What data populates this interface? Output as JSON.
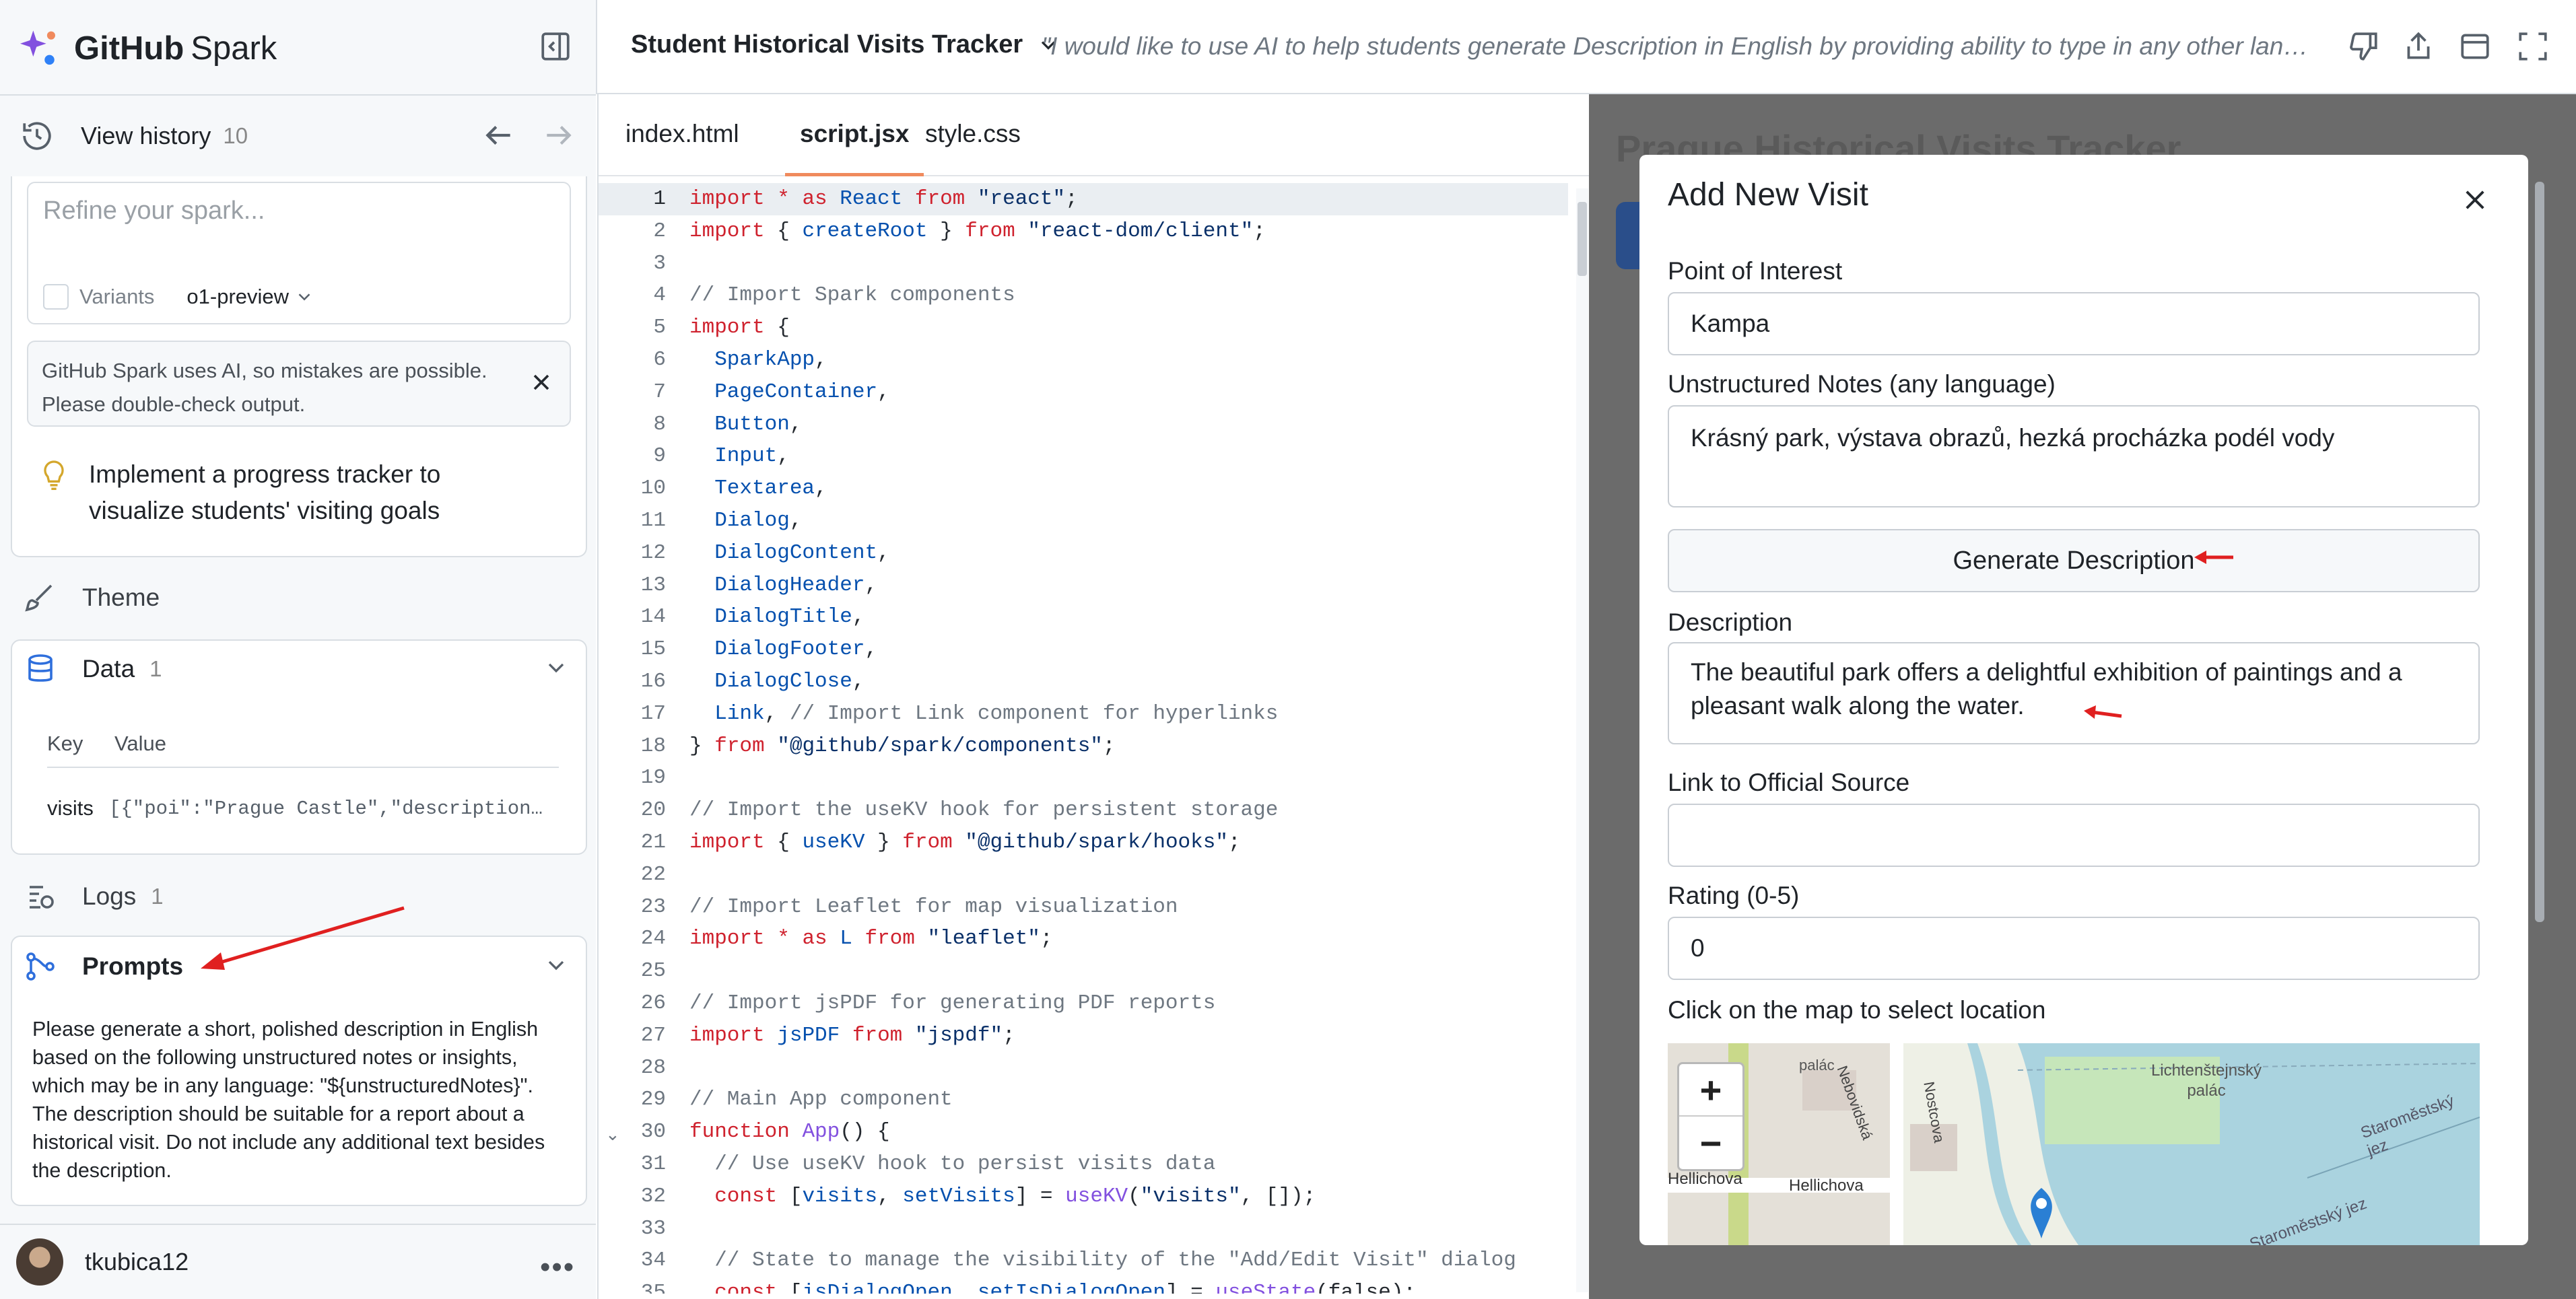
{
  "sidebar": {
    "brand": {
      "bold": "GitHub",
      "light": "Spark"
    },
    "history": {
      "label": "View history",
      "count": "10"
    },
    "refine": {
      "placeholder": "Refine your spark...",
      "variants_label": "Variants",
      "model": "o1-preview"
    },
    "notice": {
      "line1": "GitHub Spark uses AI, so mistakes are possible.",
      "line2": "Please double-check output."
    },
    "suggestion": {
      "line1": "Implement a progress tracker to",
      "line2": "visualize students' visiting goals"
    },
    "theme": {
      "label": "Theme"
    },
    "data": {
      "label": "Data",
      "count": "1",
      "col_key": "Key",
      "col_value": "Value",
      "row_key": "visits",
      "row_value": "[{\"poi\":\"Prague Castle\",\"description…"
    },
    "logs": {
      "label": "Logs",
      "count": "1"
    },
    "prompts": {
      "label": "Prompts",
      "text": "Please generate a short, polished description in English based on the following unstructured notes or insights, which may be in any language: \"${unstructuredNotes}\". The description should be suitable for a report about a historical visit. Do not include any additional text besides the description."
    },
    "user": {
      "name": "tkubica12"
    }
  },
  "topbar": {
    "project": "Student Historical Visits Tracker",
    "prompt": "\"I would like to use AI to help students generate Description in English by providing ability to type in any other language\""
  },
  "editor": {
    "tabs": [
      "index.html",
      "script.jsx",
      "style.css"
    ],
    "active_tab": "script.jsx",
    "lines": [
      [
        [
          "kw",
          "import "
        ],
        [
          "kw",
          "* as "
        ],
        [
          "id",
          "React "
        ],
        [
          "kw",
          "from "
        ],
        [
          "str",
          "\"react\""
        ],
        [
          "",
          "; "
        ]
      ],
      [
        [
          "kw",
          "import "
        ],
        [
          "",
          "{ "
        ],
        [
          "id",
          "createRoot"
        ],
        [
          "",
          " } "
        ],
        [
          "kw",
          "from "
        ],
        [
          "str",
          "\"react-dom/client\""
        ],
        [
          "",
          ";"
        ]
      ],
      [],
      [
        [
          "cm",
          "// Import Spark components"
        ]
      ],
      [
        [
          "kw",
          "import "
        ],
        [
          "",
          "{"
        ]
      ],
      [
        [
          "id",
          "  SparkApp"
        ],
        [
          "",
          ","
        ]
      ],
      [
        [
          "id",
          "  PageContainer"
        ],
        [
          "",
          ","
        ]
      ],
      [
        [
          "id",
          "  Button"
        ],
        [
          "",
          ","
        ]
      ],
      [
        [
          "id",
          "  Input"
        ],
        [
          "",
          ","
        ]
      ],
      [
        [
          "id",
          "  Textarea"
        ],
        [
          "",
          ","
        ]
      ],
      [
        [
          "id",
          "  Dialog"
        ],
        [
          "",
          ","
        ]
      ],
      [
        [
          "id",
          "  DialogContent"
        ],
        [
          "",
          ","
        ]
      ],
      [
        [
          "id",
          "  DialogHeader"
        ],
        [
          "",
          ","
        ]
      ],
      [
        [
          "id",
          "  DialogTitle"
        ],
        [
          "",
          ","
        ]
      ],
      [
        [
          "id",
          "  DialogFooter"
        ],
        [
          "",
          ","
        ]
      ],
      [
        [
          "id",
          "  DialogClose"
        ],
        [
          "",
          ","
        ]
      ],
      [
        [
          "id",
          "  Link"
        ],
        [
          ", "
        ],
        [
          "cm",
          "// Import Link component for hyperlinks"
        ]
      ],
      [
        [
          "",
          "} "
        ],
        [
          "kw",
          "from "
        ],
        [
          "str",
          "\"@github/spark/components\""
        ],
        [
          "",
          ";"
        ]
      ],
      [],
      [
        [
          "cm",
          "// Import the useKV hook for persistent storage"
        ]
      ],
      [
        [
          "kw",
          "import "
        ],
        [
          "",
          "{ "
        ],
        [
          "id",
          "useKV"
        ],
        [
          "",
          " } "
        ],
        [
          "kw",
          "from "
        ],
        [
          "str",
          "\"@github/spark/hooks\""
        ],
        [
          "",
          ";"
        ]
      ],
      [],
      [
        [
          "cm",
          "// Import Leaflet for map visualization"
        ]
      ],
      [
        [
          "kw",
          "import "
        ],
        [
          "kw",
          "* as "
        ],
        [
          "id",
          "L "
        ],
        [
          "kw",
          "from "
        ],
        [
          "str",
          "\"leaflet\""
        ],
        [
          "",
          ";"
        ]
      ],
      [],
      [
        [
          "cm",
          "// Import jsPDF for generating PDF reports"
        ]
      ],
      [
        [
          "kw",
          "import "
        ],
        [
          "id",
          "jsPDF "
        ],
        [
          "kw",
          "from "
        ],
        [
          "str",
          "\"jspdf\""
        ],
        [
          "",
          ";"
        ]
      ],
      [],
      [
        [
          "cm",
          "// Main App component"
        ]
      ],
      [
        [
          "kw",
          "function "
        ],
        [
          "fn",
          "App"
        ],
        [
          "",
          "() {"
        ]
      ],
      [
        [
          "cm",
          "  // Use useKV hook to persist visits data"
        ]
      ],
      [
        [
          "kw",
          "  const "
        ],
        [
          "",
          "["
        ],
        [
          "id",
          "visits"
        ],
        [
          "",
          ", "
        ],
        [
          "id",
          "setVisits"
        ],
        [
          "",
          "] = "
        ],
        [
          "fn",
          "useKV"
        ],
        [
          "",
          "("
        ],
        [
          "str",
          "\"visits\""
        ],
        [
          "",
          ", []);"
        ]
      ],
      [],
      [
        [
          "cm",
          "  // State to manage the visibility of the \"Add/Edit Visit\" dialog"
        ]
      ],
      [
        [
          "kw",
          "  const "
        ],
        [
          "",
          "["
        ],
        [
          "id",
          "isDialogOpen"
        ],
        [
          "",
          ", "
        ],
        [
          "id",
          "setIsDialogOpen"
        ],
        [
          "",
          "] = "
        ],
        [
          "fn",
          "useState"
        ],
        [
          "",
          "(false);"
        ]
      ]
    ]
  },
  "preview": {
    "bg_title": "Prague Historical Visits Tracker",
    "modal": {
      "title": "Add New Visit",
      "poi_label": "Point of Interest",
      "poi_value": "Kampa",
      "notes_label": "Unstructured Notes (any language)",
      "notes_value": "Krásný park, výstava obrazů, hezká procházka podél vody",
      "generate_label": "Generate Description",
      "desc_label": "Description",
      "desc_line1": "The beautiful park offers a delightful exhibition of paintings and a",
      "desc_line2": "pleasant walk along the water.",
      "link_label": "Link to Official Source",
      "link_value": "",
      "rating_label": "Rating (0-5)",
      "rating_value": "0",
      "map_label": "Click on the map to select location",
      "map_labels": [
        "Hellichova",
        "Hellichova",
        "Nebovidská",
        "Nostcova",
        "Lichtenštejnský palác",
        "Staroměstský jez",
        "Staroměstský jez",
        "palác"
      ]
    }
  },
  "colors": {
    "accent_orange": "#f08a5d",
    "keyword": "#cf222e",
    "identifier": "#0550ae",
    "string": "#0a3069",
    "annotation_arrow": "#e02020"
  }
}
